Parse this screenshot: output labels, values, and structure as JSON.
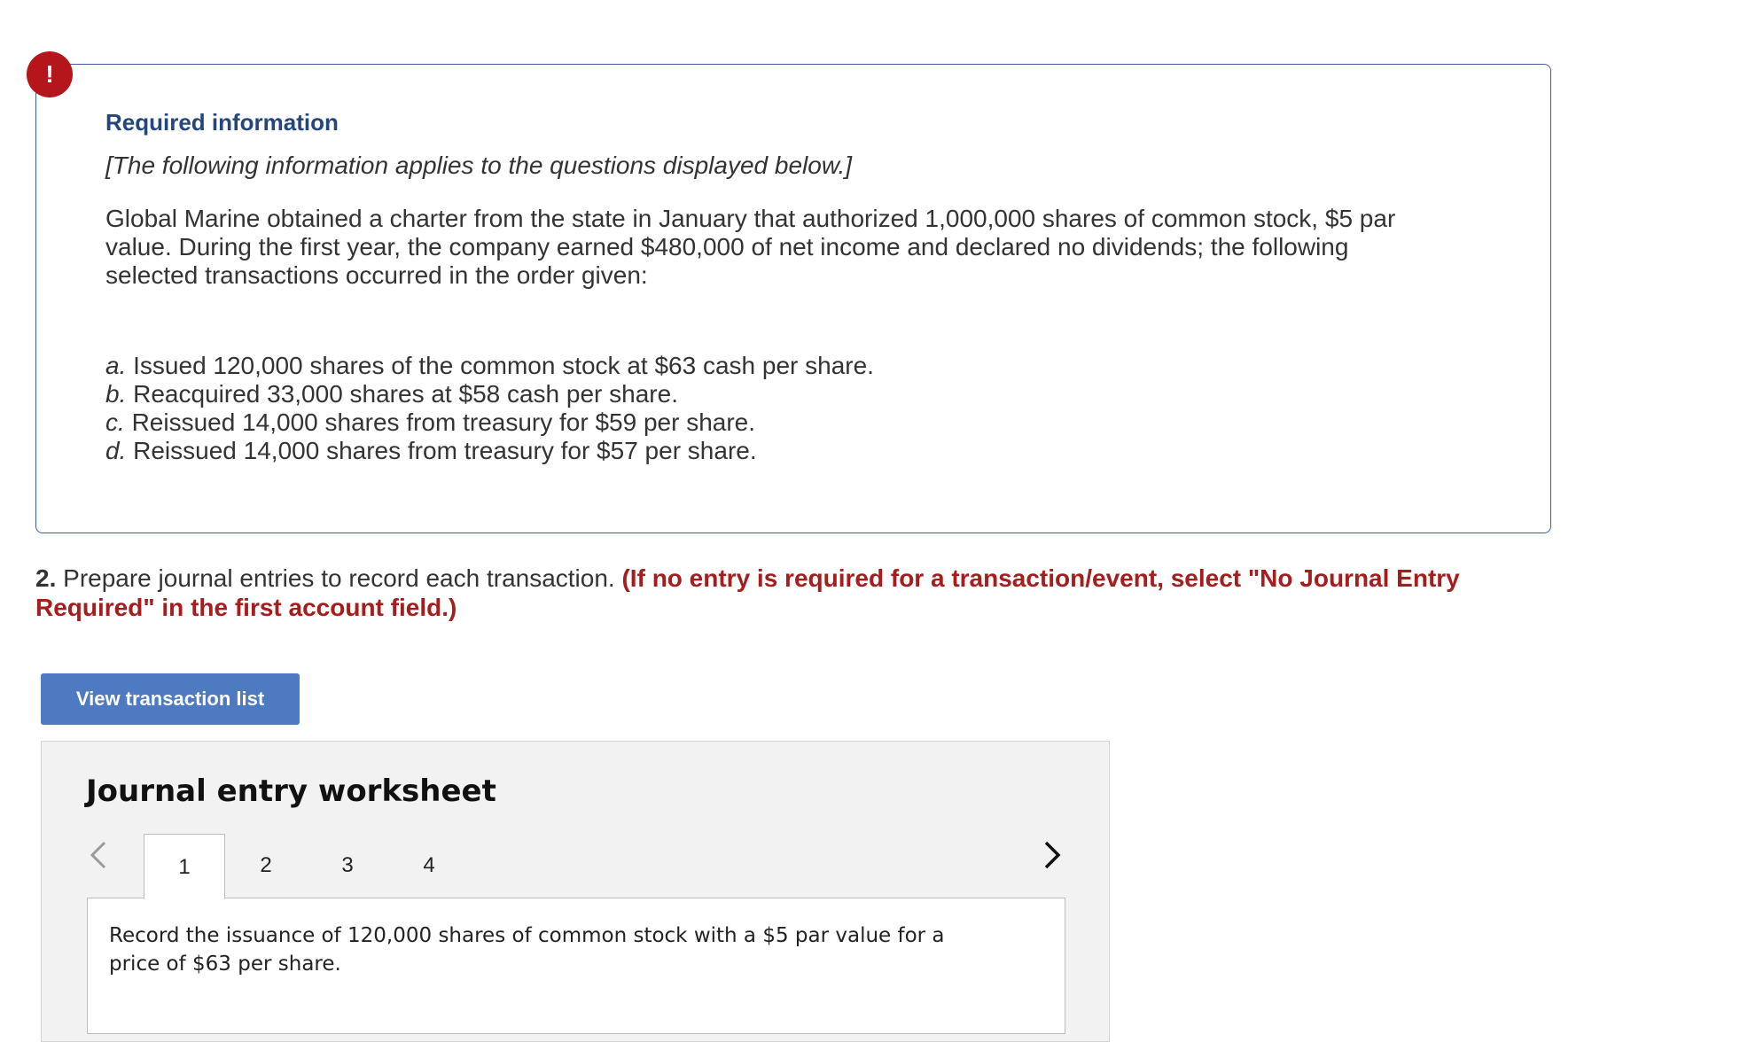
{
  "alert": {
    "symbol": "!"
  },
  "info": {
    "title": "Required information",
    "subtitle": "[The following information applies to the questions displayed below.]",
    "paragraph": "Global Marine obtained a charter from the state in January that authorized 1,000,000 shares of common stock, $5 par value. During the first year, the company earned $480,000 of net income and declared no dividends; the following selected transactions occurred in the order given:",
    "transactions": [
      {
        "letter": "a.",
        "text": "Issued 120,000 shares of the common stock at $63 cash per share."
      },
      {
        "letter": "b.",
        "text": "Reacquired 33,000 shares at $58 cash per share."
      },
      {
        "letter": "c.",
        "text": "Reissued 14,000 shares from treasury for $59 per share."
      },
      {
        "letter": "d.",
        "text": "Reissued 14,000 shares from treasury for $57 per share."
      }
    ]
  },
  "question": {
    "number": "2.",
    "text": "Prepare journal entries to record each transaction.",
    "note": "(If no entry is required for a transaction/event, select \"No Journal Entry Required\" in the first account field.)"
  },
  "view_button": {
    "label": "View transaction list"
  },
  "worksheet": {
    "title": "Journal entry worksheet",
    "tabs": [
      "1",
      "2",
      "3",
      "4"
    ],
    "active_tab": "1",
    "description": "Record the issuance of 120,000 shares of common stock with a $5 par value for a price of $63 per share."
  },
  "colors": {
    "alert": "#b5161c",
    "title_blue": "#23467f",
    "border_blue": "#3d5f9e",
    "note_red": "#a51d1d",
    "button_blue": "#4d7ac0"
  }
}
